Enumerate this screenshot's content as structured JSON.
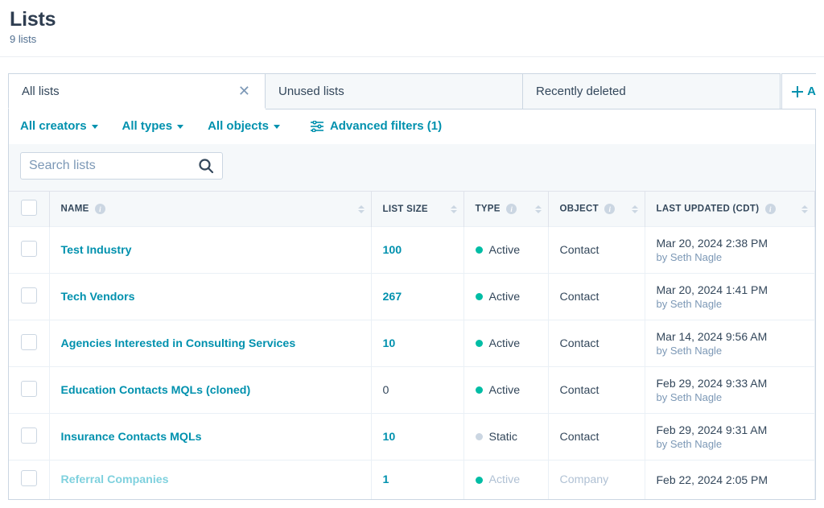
{
  "page": {
    "title": "Lists",
    "subtitle": "9 lists"
  },
  "tabs": [
    {
      "label": "All lists",
      "closable": true,
      "active": true
    },
    {
      "label": "Unused lists",
      "closable": false,
      "active": false
    },
    {
      "label": "Recently deleted",
      "closable": false,
      "active": false
    }
  ],
  "add_view_label": "A",
  "filters": {
    "creators": "All creators",
    "types": "All types",
    "objects": "All objects",
    "advanced": "Advanced filters (1)"
  },
  "search": {
    "placeholder": "Search lists",
    "value": ""
  },
  "table": {
    "columns": {
      "name": "NAME",
      "size": "LIST SIZE",
      "type": "TYPE",
      "object": "OBJECT",
      "updated": "LAST UPDATED (CDT)"
    },
    "rows": [
      {
        "name": "Test Industry",
        "size": "100",
        "size_link": true,
        "type": "Active",
        "type_kind": "active",
        "object": "Contact",
        "updated": "Mar 20, 2024 2:38 PM",
        "by": "by Seth Nagle"
      },
      {
        "name": "Tech Vendors",
        "size": "267",
        "size_link": true,
        "type": "Active",
        "type_kind": "active",
        "object": "Contact",
        "updated": "Mar 20, 2024 1:41 PM",
        "by": "by Seth Nagle"
      },
      {
        "name": "Agencies Interested in Consulting Services",
        "size": "10",
        "size_link": true,
        "type": "Active",
        "type_kind": "active",
        "object": "Contact",
        "updated": "Mar 14, 2024 9:56 AM",
        "by": "by Seth Nagle"
      },
      {
        "name": "Education Contacts MQLs (cloned)",
        "size": "0",
        "size_link": false,
        "type": "Active",
        "type_kind": "active",
        "object": "Contact",
        "updated": "Feb 29, 2024 9:33 AM",
        "by": "by Seth Nagle"
      },
      {
        "name": "Insurance Contacts MQLs",
        "size": "10",
        "size_link": true,
        "type": "Static",
        "type_kind": "static",
        "object": "Contact",
        "updated": "Feb 29, 2024 9:31 AM",
        "by": "by Seth Nagle"
      },
      {
        "name": "Referral Companies",
        "size": "1",
        "size_link": true,
        "type": "Active",
        "type_kind": "active",
        "object": "Company",
        "updated": "Feb 22, 2024 2:05 PM",
        "by": ""
      }
    ]
  }
}
